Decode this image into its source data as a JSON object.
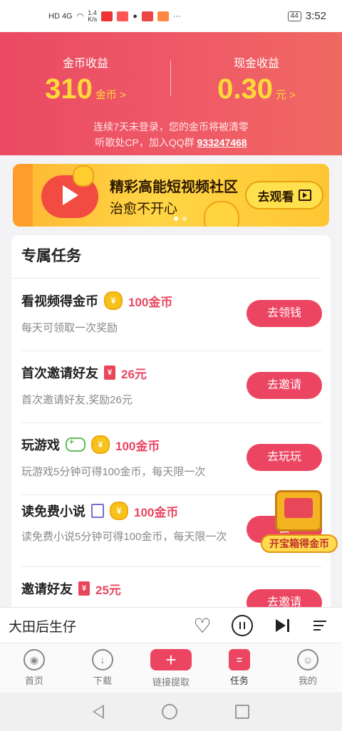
{
  "status": {
    "network": "HD 4G",
    "speed": "1.4\nK/s",
    "battery": "44",
    "time": "3:52"
  },
  "header": {
    "coin_label": "金币收益",
    "coin_amount": "310",
    "coin_unit": "金币 >",
    "cash_label": "现金收益",
    "cash_amount": "0.30",
    "cash_unit": "元 >",
    "notice_line1": "连续7天未登录，您的金币将被清零",
    "notice_line2": "听歌处CP，加入QQ群",
    "qq_group": "933247468"
  },
  "banner": {
    "title": "精彩高能短视频社区",
    "subtitle": "治愈不开心",
    "button": "去观看"
  },
  "tasks_section": {
    "title": "专属任务",
    "items": [
      {
        "name": "看视频得金币",
        "reward": "100金币",
        "desc": "每天可领取一次奖励",
        "button": "去领钱"
      },
      {
        "name": "首次邀请好友",
        "reward": "26元",
        "desc": "首次邀请好友,奖励26元",
        "button": "去邀请"
      },
      {
        "name": "玩游戏",
        "reward": "100金币",
        "desc": "玩游戏5分钟可得100金币，每天限一次",
        "button": "去玩玩"
      },
      {
        "name": "读免费小说",
        "reward": "100金币",
        "desc": "读免费小说5分钟可得100金币，每天限一次",
        "button": "去"
      },
      {
        "name": "邀请好友",
        "reward": "25元",
        "desc": "",
        "button": "去邀请"
      }
    ]
  },
  "treasure": {
    "label": "开宝箱得金币"
  },
  "player": {
    "song": "大田后生仔"
  },
  "tabs": [
    {
      "label": "首页"
    },
    {
      "label": "下载"
    },
    {
      "label": "链接提取"
    },
    {
      "label": "任务"
    },
    {
      "label": "我的"
    }
  ],
  "colors": {
    "accent": "#ec4562",
    "gold": "#ffd93a"
  }
}
